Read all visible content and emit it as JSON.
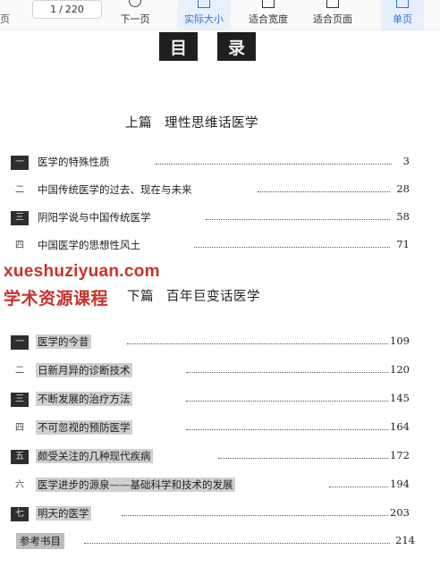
{
  "toolbar": {
    "cut_label": "页",
    "page": {
      "current": "1",
      "separator": "/",
      "total": "220"
    },
    "next_label": "下一页",
    "actual_size_label": "实际大小",
    "fit_width_label": "适合宽度",
    "fit_page_label": "适合页面",
    "single_page_label": "单页"
  },
  "doc": {
    "heading": [
      "目",
      "录"
    ],
    "part1": {
      "label": "上篇",
      "title": "理性思维话医学"
    },
    "part2": {
      "label": "下篇",
      "title": "百年巨变话医学"
    },
    "part1_entries": [
      {
        "num": "一",
        "title": "医学的特殊性质",
        "page": "3"
      },
      {
        "num": "二",
        "title": "中国传统医学的过去、现在与未来",
        "page": "28"
      },
      {
        "num": "三",
        "title": "阴阳学说与中国传统医学",
        "page": "58"
      },
      {
        "num": "四",
        "title": "中国医学的思想性风土",
        "page": "71"
      }
    ],
    "part2_entries": [
      {
        "num": "一",
        "title": "医学的今昔",
        "page": "109"
      },
      {
        "num": "二",
        "title": "日新月异的诊断技术",
        "page": "120"
      },
      {
        "num": "三",
        "title": "不断发展的治疗方法",
        "page": "145"
      },
      {
        "num": "四",
        "title": "不可忽视的预防医学",
        "page": "164"
      },
      {
        "num": "五",
        "title": "颇受关注的几种现代疾病",
        "page": "172"
      },
      {
        "num": "六",
        "title": "医学进步的源泉——基础科学和技术的发展",
        "page": "194"
      },
      {
        "num": "七",
        "title": "明天的医学",
        "page": "203"
      }
    ],
    "references": {
      "title": "参考书目",
      "page": "214"
    }
  },
  "watermark": {
    "line1": "xueshuziyuan.com",
    "line2": "学术资源课程"
  }
}
